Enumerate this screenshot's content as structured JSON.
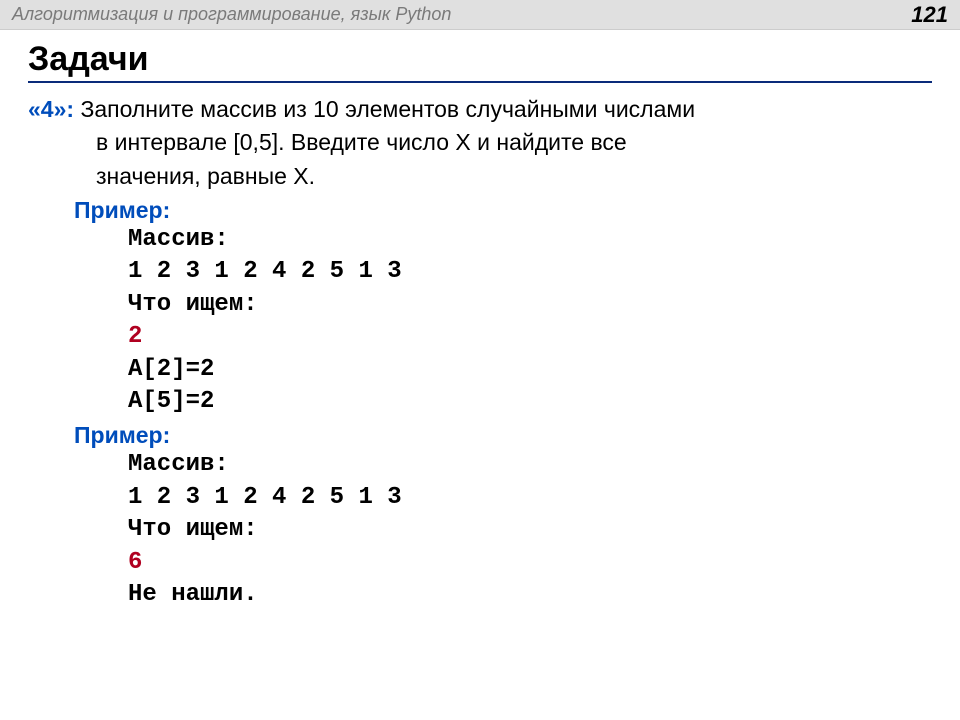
{
  "header": {
    "title": "Алгоритмизация и программирование, язык Python",
    "page_number": "121"
  },
  "section_title": "Задачи",
  "task": {
    "grade_label": "«4»: ",
    "line1": "Заполните массив из 10 элементов случайными числами",
    "line2": "в интервале [0,5]. Введите число X и найдите все",
    "line3": "значения, равные X."
  },
  "example1": {
    "label": "Пример:",
    "array_label": "Массив:",
    "array_values": "1 2 3 1 2 4 2 5 1 3",
    "search_label": "Что ищем:",
    "search_value": "2",
    "result1": "A[2]=2",
    "result2": "A[5]=2"
  },
  "example2": {
    "label": "Пример:",
    "array_label": "Массив:",
    "array_values": "1 2 3 1 2 4 2 5 1 3",
    "search_label": "Что ищем:",
    "search_value": "6",
    "result": "Не нашли."
  }
}
